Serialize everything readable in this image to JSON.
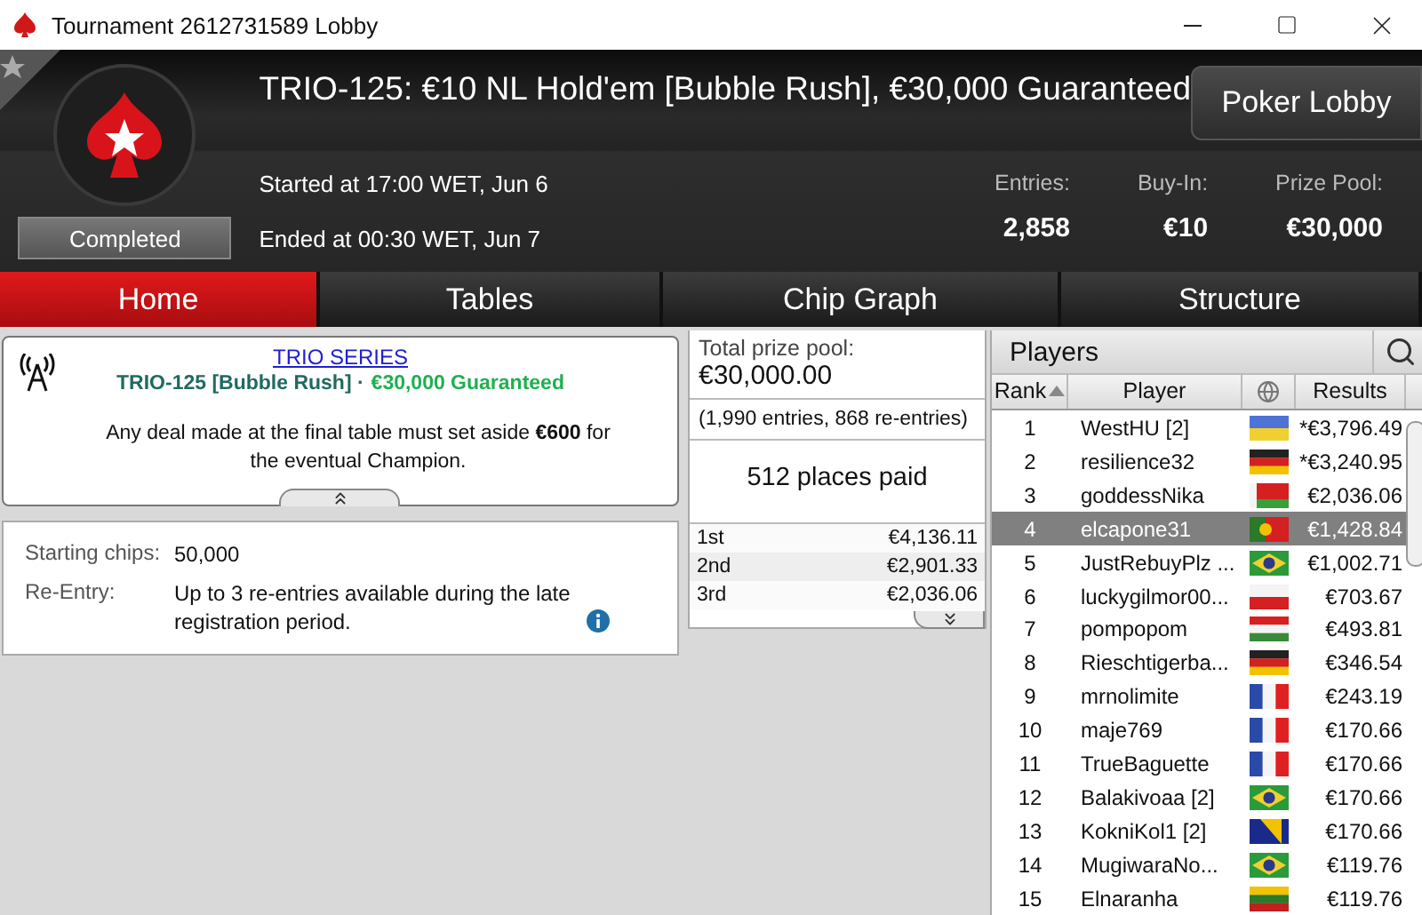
{
  "window": {
    "title": "Tournament 2612731589 Lobby"
  },
  "header": {
    "title": "TRIO-125: €10 NL Hold'em [Bubble Rush], €30,000 Guaranteed",
    "status": "Completed",
    "started": "Started at 17:00 WET, Jun 6",
    "ended": "Ended at 00:30 WET, Jun 7",
    "lobby_button": "Poker Lobby",
    "stats": [
      {
        "label": "Entries:",
        "value": "2,858"
      },
      {
        "label": "Buy-In:",
        "value": "€10"
      },
      {
        "label": "Prize Pool:",
        "value": "€30,000"
      }
    ]
  },
  "tabs": [
    {
      "label": "Home",
      "selected": true
    },
    {
      "label": "Tables",
      "selected": false
    },
    {
      "label": "Chip Graph",
      "selected": false
    },
    {
      "label": "Structure",
      "selected": false
    }
  ],
  "notice": {
    "link": "TRIO SERIES",
    "name": "TRIO-125 [Bubble Rush] ·",
    "guarantee": "€30,000 Guaranteed",
    "message": "Any deal made at the final table must set aside **€600** for the eventual Champion."
  },
  "details": [
    {
      "label": "Starting chips:",
      "value": "50,000",
      "info": false
    },
    {
      "label": "Re-Entry:",
      "value": "Up to 3 re-entries available during the late registration period.",
      "info": true
    }
  ],
  "prize": {
    "label": "Total prize pool:",
    "amount": "€30,000.00",
    "entries": "(1,990 entries, 868 re-entries)",
    "places": "512 places paid",
    "payouts": [
      {
        "place": "1st",
        "amount": "€4,136.11"
      },
      {
        "place": "2nd",
        "amount": "€2,901.33"
      },
      {
        "place": "3rd",
        "amount": "€2,036.06"
      }
    ]
  },
  "players": {
    "title": "Players",
    "columns": [
      "Rank",
      "Player",
      "Results"
    ],
    "rows": [
      {
        "rank": "1",
        "player": "WestHU [2]",
        "result": "*€3,796.49",
        "selected": false,
        "flag": {
          "kind": "ukraine"
        }
      },
      {
        "rank": "2",
        "player": "resilience32",
        "result": "*€3,240.95",
        "selected": false,
        "flag": {
          "kind": "germany"
        }
      },
      {
        "rank": "3",
        "player": "goddessNika",
        "result": "€2,036.06",
        "selected": false,
        "flag": {
          "kind": "belarus"
        }
      },
      {
        "rank": "4",
        "player": "elcapone31",
        "result": "€1,428.84",
        "selected": true,
        "flag": {
          "kind": "portugal"
        }
      },
      {
        "rank": "5",
        "player": "JustRebuyPlz ...",
        "result": "€1,002.71",
        "selected": false,
        "flag": {
          "kind": "brazil"
        }
      },
      {
        "rank": "6",
        "player": "luckygilmor00...",
        "result": "€703.67",
        "selected": false,
        "flag": {
          "kind": "poland"
        }
      },
      {
        "rank": "7",
        "player": "pompopom",
        "result": "€493.81",
        "selected": false,
        "flag": {
          "kind": "hungary"
        }
      },
      {
        "rank": "8",
        "player": "Rieschtigerba...",
        "result": "€346.54",
        "selected": false,
        "flag": {
          "kind": "germany"
        }
      },
      {
        "rank": "9",
        "player": "mrnolimite",
        "result": "€243.19",
        "selected": false,
        "flag": {
          "kind": "france"
        }
      },
      {
        "rank": "10",
        "player": "maje769",
        "result": "€170.66",
        "selected": false,
        "flag": {
          "kind": "france"
        }
      },
      {
        "rank": "11",
        "player": "TrueBaguette",
        "result": "€170.66",
        "selected": false,
        "flag": {
          "kind": "france"
        }
      },
      {
        "rank": "12",
        "player": "Balakivoaa [2]",
        "result": "€170.66",
        "selected": false,
        "flag": {
          "kind": "brazil"
        }
      },
      {
        "rank": "13",
        "player": "KokniKol1 [2]",
        "result": "€170.66",
        "selected": false,
        "flag": {
          "kind": "bosnia"
        }
      },
      {
        "rank": "14",
        "player": "MugiwaraNo...",
        "result": "€119.76",
        "selected": false,
        "flag": {
          "kind": "brazil"
        }
      },
      {
        "rank": "15",
        "player": "Elnaranha",
        "result": "€119.76",
        "selected": false,
        "flag": {
          "kind": "lithuania"
        }
      }
    ]
  }
}
